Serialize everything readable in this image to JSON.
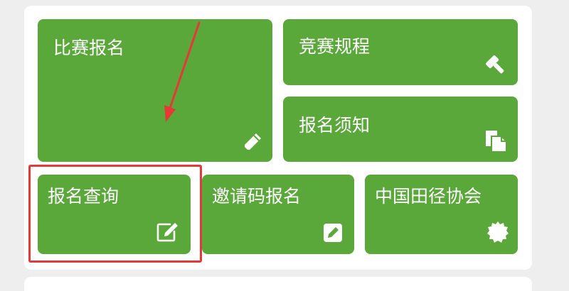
{
  "colors": {
    "tile_green": "#5aa83a",
    "annotation_red": "#e53935",
    "panel_bg": "#ffffff",
    "page_bg": "#eeeeee"
  },
  "tiles": [
    {
      "label": "比赛报名",
      "icon": "pencil-icon"
    },
    {
      "label": "竞赛规程",
      "icon": "gavel-icon"
    },
    {
      "label": "报名须知",
      "icon": "document-copy-icon"
    },
    {
      "label": "报名查询",
      "icon": "edit-square-icon"
    },
    {
      "label": "邀请码报名",
      "icon": "pencil-square-icon"
    },
    {
      "label": "中国田径协会",
      "icon": "badge-seal-icon"
    }
  ],
  "annotations": {
    "arrow": "red-arrow-icon",
    "highlight": "red-highlight-box"
  }
}
